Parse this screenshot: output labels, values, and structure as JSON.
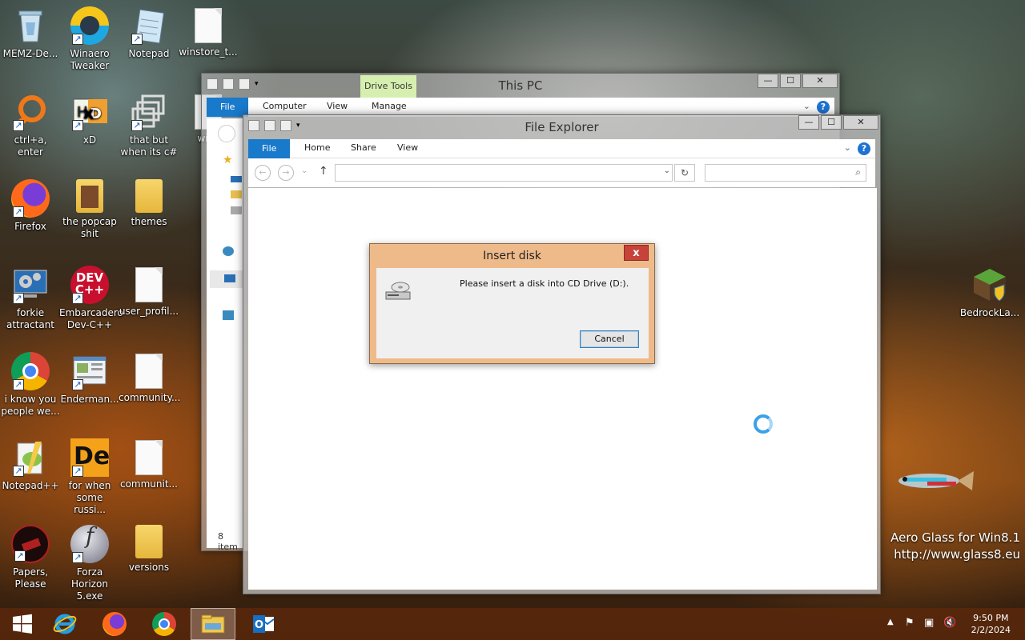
{
  "desktop": {
    "icons": [
      {
        "label": "MEMZ-De...",
        "icon": "recycle-bin-icon"
      },
      {
        "label": "Winaero Tweaker",
        "icon": "winaero-icon"
      },
      {
        "label": "Notepad",
        "icon": "notepad-icon"
      },
      {
        "label": "winstore_t...",
        "icon": "document-icon"
      },
      {
        "label": "ctrl+a, enter",
        "icon": "search-ring-icon"
      },
      {
        "label": "xD",
        "icon": "xd-icon"
      },
      {
        "label": "that but when its c#",
        "icon": "windows-stack-icon"
      },
      {
        "label": "wins",
        "icon": "document-icon"
      },
      {
        "label": "Firefox",
        "icon": "firefox-icon"
      },
      {
        "label": "the popcap shit",
        "icon": "folder-icon"
      },
      {
        "label": "themes",
        "icon": "folder-icon"
      },
      {
        "label": "forkie attractant",
        "icon": "settings-monitor-icon"
      },
      {
        "label": "Embarcadero Dev-C++",
        "icon": "devcpp-icon"
      },
      {
        "label": "user_profil...",
        "icon": "document-icon"
      },
      {
        "label": "i know you people we...",
        "icon": "chrome-icon"
      },
      {
        "label": "Enderman...",
        "icon": "window-image-icon"
      },
      {
        "label": "community...",
        "icon": "document-icon"
      },
      {
        "label": "Notepad++",
        "icon": "notepadpp-icon"
      },
      {
        "label": "for when some russi...",
        "icon": "de-icon"
      },
      {
        "label": "communit...",
        "icon": "document-icon"
      },
      {
        "label": "Papers, Please",
        "icon": "papers-please-icon"
      },
      {
        "label": "Forza Horizon 5.exe",
        "icon": "flash-icon"
      },
      {
        "label": "versions",
        "icon": "folder-icon"
      },
      {
        "label": "BedrockLa...",
        "icon": "minecraft-icon"
      }
    ]
  },
  "this_pc": {
    "title": "This PC",
    "contextual_tab": "Drive Tools",
    "tabs": [
      "File",
      "Computer",
      "View",
      "Manage"
    ],
    "status": "8 item"
  },
  "explorer": {
    "title": "File Explorer",
    "tabs": [
      "File",
      "Home",
      "Share",
      "View"
    ],
    "address": "",
    "search_placeholder": ""
  },
  "dialog": {
    "title": "Insert disk",
    "message": "Please insert a disk into CD Drive (D:).",
    "cancel_label": "Cancel",
    "close_glyph": "x"
  },
  "watermark": {
    "line1": "Aero Glass for Win8.1",
    "line2": "http://www.glass8.eu"
  },
  "window_controls": {
    "minimize": "—",
    "maximize": "☐",
    "close": "✕"
  },
  "taskbar": {
    "apps": [
      "start",
      "internet-explorer",
      "firefox",
      "chrome",
      "file-explorer",
      "outlook"
    ],
    "clock_time": "9:50 PM",
    "clock_date": "2/2/2024"
  },
  "colors": {
    "ribbon_file": "#1979ca",
    "dialog_frame": "#efba8a",
    "close_button": "#c7433a",
    "spinner": "#3aa0e8"
  }
}
